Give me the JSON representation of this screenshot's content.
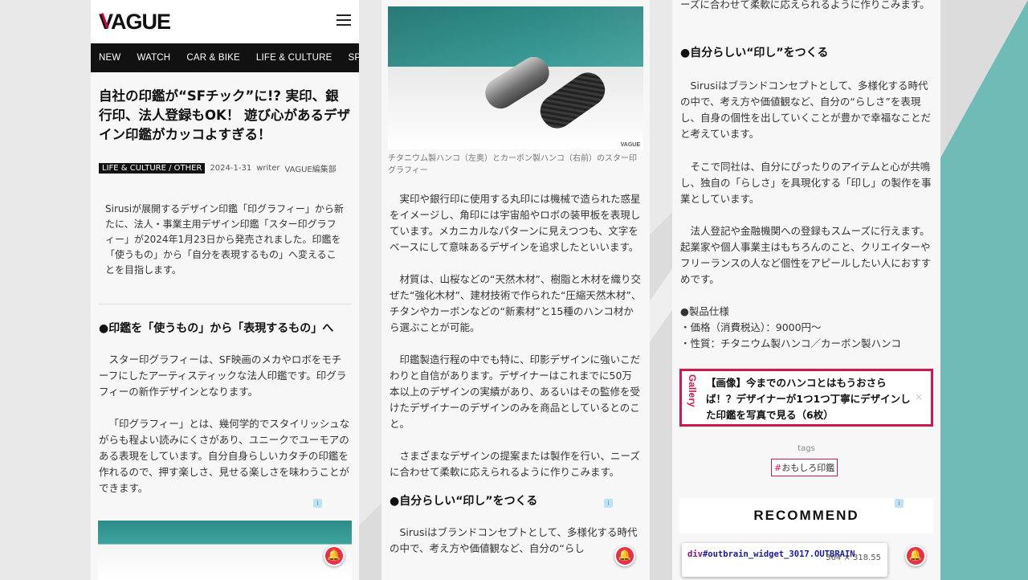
{
  "site": {
    "logo": "VAGUE"
  },
  "nav": [
    "NEW",
    "WATCH",
    "CAR & BIKE",
    "LIFE & CULTURE",
    "SPEC"
  ],
  "article": {
    "title": "自社の印鑑が“SFチック”に!? 実印、銀行印、法人登録もOK！ 遊び心があるデザイン印鑑がカッコよすぎる！",
    "category": "LIFE & CULTURE / OTHER",
    "date": "2024-1-31",
    "writer_label": "writer",
    "writer": "VAGUE編集部",
    "lead": "Sirusiが展開するデザイン印鑑「印グラフィー」から新たに、法人・事業主用デザイン印鑑「スター印グラフィー」が2024年1月23日から発売されました。印鑑を「使うもの」から「自分を表現するもの」へ変えることを目指します。",
    "section1_heading": "●印鑑を「使うもの」から「表現するもの」へ",
    "section1_p1": "スター印グラフィーは、SF映画のメカやロボをモチーフにしたアーティスティックな法人印鑑です。印グラフィーの新作デザインとなります。",
    "section1_p2": "「印グラフィー」とは、幾何学的でスタイリッシュながらも程よい読みにくさがあり、ユニークでユーモアのある表現をしています。自分自身らしいカタチの印鑑を作れるので、押す楽しさ、見せる楽しさを味わうことができます。",
    "image_credit": "VAGUE",
    "image_caption": "チタニウム製ハンコ（左奥）とカーボン製ハンコ（右前）のスター印グラフィー",
    "p_design": "実印や銀行印に使用する丸印には機械で造られた惑星をイメージし、角印には宇宙船やロボの装甲板を表現しています。メカニカルなパターンに見えつつも、文字をベースにして意味あるデザインを追求したといいます。",
    "p_material": "材質は、山桜などの“天然木材”、樹脂と木材を織り交ぜた“強化木材”、建材技術で作られた“圧縮天然木材”、チタンやカーボンなどの“新素材”と15種のハンコ材から選ぶことが可能。",
    "p_craft": "印鑑製造行程の中でも特に、印影デザインに強いこだわりと自信があります。デザイナーはこれまでに50万本以上のデザインの実績があり、あるいはその監修を受けたデザイナーのデザインのみを商品としているとのこと。",
    "p_custom": "さまざまなデザインの提案または製作を行い、ニーズに合わせて柔軟に応えられるように作りこみます。",
    "p_custom_tail": "ーズに合わせて柔軟に応えられるように作りこみます。",
    "section2_heading": "●自分らしい“印し”をつくる",
    "p_brand": "Sirusiはブランドコンセプトとして、多様化する時代の中で、考え方や価値観など、自分の“らしさ”を表現し、自身の個性を出していくことが豊かで幸福なことだと考えています。",
    "p_brand_cut": "Sirusiはブランドコンセプトとして、多様化する時代の中で、考え方や価値観など、自分の“らし",
    "p_company": "そこで同社は、自分にぴったりのアイテムと心が共鳴し、独自の「らしさ」を具現化する「印し」の製作を事業としています。",
    "p_corp": "法人登記や金融機関への登録もスムーズに行えます。起業家や個人事業主はもちろんのこと、クリエイターやフリーランスの人など個性をアピールしたい人におすすめです。",
    "spec_heading": "●製品仕様",
    "spec_price": "・価格（消費税込）：9000円〜",
    "spec_material": "・性質：チタニウム製ハンコ／カーボン製ハンコ"
  },
  "gallery": {
    "label": "Gallery",
    "text": "【画像】今までのハンコとはもうおさらば！？デザイナーが1つ1つ丁寧にデザインした印鑑を写真で見る（6枚）",
    "close": "×"
  },
  "tags": {
    "label": "tags",
    "hash": "#",
    "items": [
      "おもしろ印鑑"
    ]
  },
  "recommend": "RECOMMEND",
  "devtools_tip": {
    "tag": "div",
    "selector": "#outbrain_widget_3017.OUTBRAIN",
    "size": "364 × 318.55"
  },
  "icons": {
    "menu": "hamburger-icon",
    "notification": "bell-icon",
    "ad": "ad-choices-icon"
  },
  "colors": {
    "accent": "#d0174e",
    "nav_bg": "#111111",
    "bell": "#e8304a",
    "teal": "#6fbcb6"
  }
}
